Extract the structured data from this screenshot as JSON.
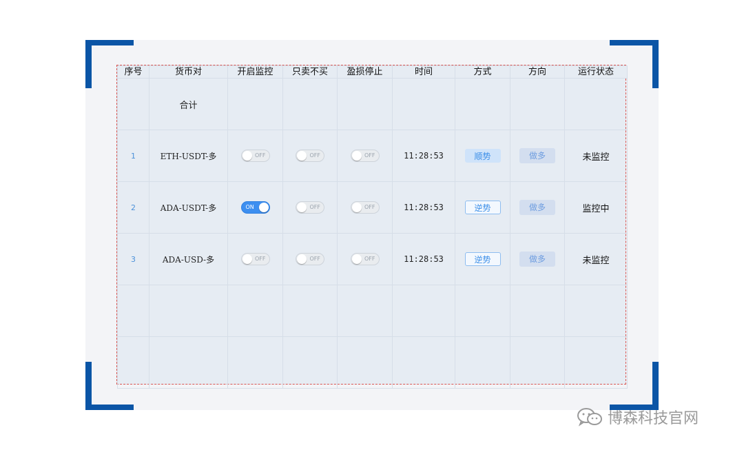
{
  "columns": [
    "序号",
    "货币对",
    "开启监控",
    "只卖不买",
    "盈损停止",
    "时间",
    "方式",
    "方向",
    "运行状态"
  ],
  "summary_row": {
    "label": "合计"
  },
  "rows": [
    {
      "index": "1",
      "pair": "ETH-USDT-多",
      "monitor": "OFF",
      "sell_only": "OFF",
      "stop_loss": "OFF",
      "time": "11:28:53",
      "mode": "顺势",
      "direction": "做多",
      "status": "未监控"
    },
    {
      "index": "2",
      "pair": "ADA-USDT-多",
      "monitor": "ON",
      "sell_only": "OFF",
      "stop_loss": "OFF",
      "time": "11:28:53",
      "mode": "逆势",
      "direction": "做多",
      "status": "监控中"
    },
    {
      "index": "3",
      "pair": "ADA-USD-多",
      "monitor": "OFF",
      "sell_only": "OFF",
      "stop_loss": "OFF",
      "time": "11:28:53",
      "mode": "逆势",
      "direction": "做多",
      "status": "未监控"
    }
  ],
  "watermark": {
    "text": "博森科技官网",
    "icon": "wechat-icon"
  },
  "colors": {
    "accent": "#0b55a6",
    "toggle_on": "#3d8ff0",
    "link": "#3b8ee8"
  }
}
